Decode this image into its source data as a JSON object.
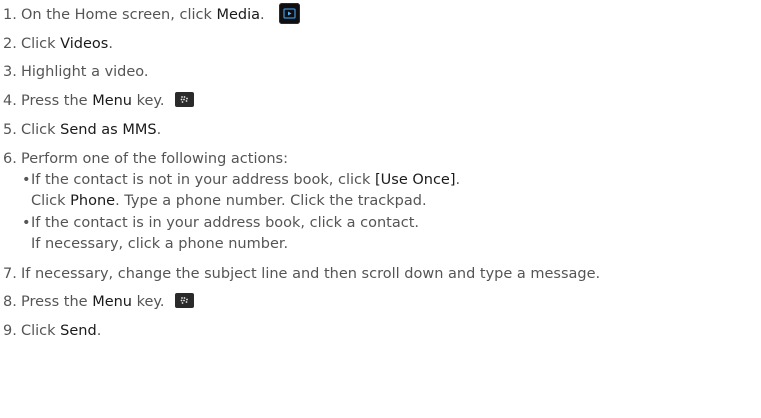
{
  "steps": {
    "s1": {
      "num": "1.",
      "pre": "On the Home screen, click ",
      "bold": "Media",
      "post": "."
    },
    "s2": {
      "num": "2.",
      "pre": "Click ",
      "bold": "Videos",
      "post": "."
    },
    "s3": {
      "num": "3.",
      "text": "Highlight a video."
    },
    "s4": {
      "num": "4.",
      "pre": "Press the ",
      "bold": "Menu",
      "post": " key."
    },
    "s5": {
      "num": "5.",
      "pre": "Click ",
      "bold": "Send as MMS",
      "post": "."
    },
    "s6": {
      "num": "6.",
      "text": "Perform one of the following actions:"
    },
    "s6a_line1": {
      "bullet": "•",
      "pre": "If the contact is not in your address book, click ",
      "bold": "[Use Once]",
      "post": "."
    },
    "s6a_line2": {
      "pre": "Click ",
      "bold": "Phone",
      "post": ". Type a phone number. Click the trackpad."
    },
    "s6b_line1": {
      "bullet": "•",
      "text": "If the contact is in your address book, click a contact."
    },
    "s6b_line2": {
      "text": "If necessary, click a phone number."
    },
    "s7": {
      "num": "7.",
      "text": "If necessary, change the subject line and then scroll down and type a message."
    },
    "s8": {
      "num": "8.",
      "pre": "Press the ",
      "bold": "Menu",
      "post": " key."
    },
    "s9": {
      "num": "9.",
      "pre": "Click ",
      "bold": "Send",
      "post": "."
    }
  },
  "icons": {
    "media": "media-app-icon",
    "menu": "blackberry-menu-key-icon"
  },
  "colors": {
    "text": "#555555",
    "bold": "#1a1a1a",
    "media_icon_bg": "#0f0f12",
    "media_icon_accent": "#3a8fd6"
  }
}
